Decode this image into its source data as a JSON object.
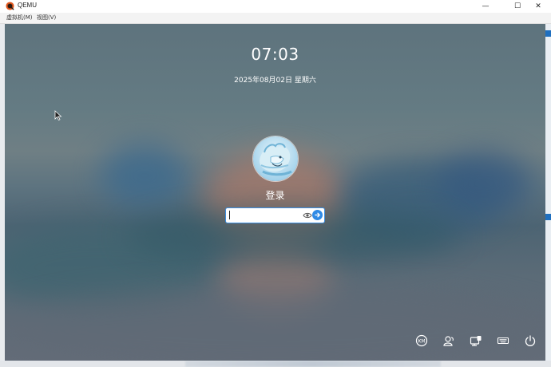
{
  "window": {
    "title": "QEMU",
    "controls": {
      "minimize": "—",
      "maximize": "☐",
      "close": "✕"
    }
  },
  "menu": {
    "items": [
      {
        "label": "虚拟机(M)"
      },
      {
        "label": "视图(V)"
      }
    ]
  },
  "lockscreen": {
    "time": "07:03",
    "date": "2025年08月02日 星期六",
    "username": "登录",
    "password": {
      "value": "",
      "placeholder": ""
    },
    "icons": {
      "reveal": "eye-icon",
      "submit": "arrow-right-icon"
    }
  },
  "tray": [
    {
      "name": "keyboard-layout-icon"
    },
    {
      "name": "switch-user-icon"
    },
    {
      "name": "network-icon"
    },
    {
      "name": "virtual-keyboard-icon"
    },
    {
      "name": "power-icon"
    }
  ],
  "colors": {
    "accent": "#2f8ae5",
    "field_border": "#3b8ee0"
  }
}
